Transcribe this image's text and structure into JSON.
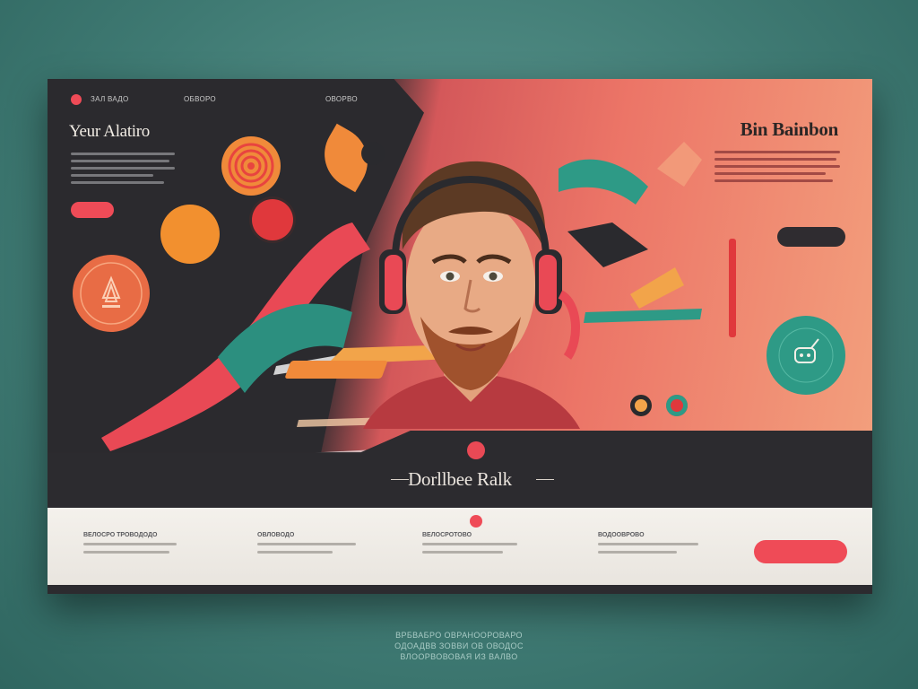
{
  "nav": {
    "items": [
      "ЗАЛ ВАДО",
      "ОБВОРО",
      "ОВОРВО"
    ]
  },
  "left_panel": {
    "title": "Yeur Alatiro",
    "cta": ""
  },
  "right_panel": {
    "title": "Bin Bainbon",
    "cta": ""
  },
  "banner": {
    "title": "Dorllbee Ralk"
  },
  "footer": {
    "columns": [
      {
        "heading": "ВЕЛОСРО ТРОВОДОДО"
      },
      {
        "heading": "ОВЛОВОДО"
      },
      {
        "heading": "ВЕЛОСРОТОВО"
      },
      {
        "heading": "ВОДООВРОВО"
      }
    ],
    "cta": ""
  },
  "caption": {
    "lines": [
      "ВРБВАБРО ОВРАНООРОВАРО",
      "ОДОАДВВ ЗОВВИ ОВ ОВОДОС",
      "ВЛООРВОВОВАЯ ИЗ ВАЛВО"
    ]
  },
  "colors": {
    "accent_red": "#ef4b57",
    "dark_panel": "#2b2a2e",
    "teal": "#2e9a86",
    "orange": "#f08a3a",
    "coral_bg": "#ec7567",
    "page_bg": "#3f7a73"
  },
  "icons": {
    "right_badge": "mascot-badge-icon",
    "left_badge": "tree-badge-icon"
  }
}
